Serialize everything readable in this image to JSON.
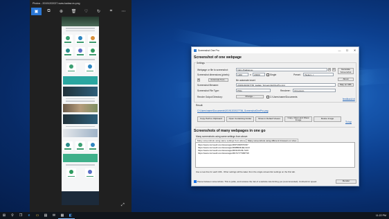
{
  "photos": {
    "title": "Photos - 20191202027.www.kadaw-eu.png",
    "toolbar": [
      {
        "icon": "image-icon",
        "glyph": "▣"
      },
      {
        "icon": "copy-icon",
        "glyph": "⧉"
      },
      {
        "icon": "zoom-icon",
        "glyph": "⊕"
      },
      {
        "icon": "delete-icon",
        "glyph": "🗑"
      },
      {
        "icon": "heart-icon",
        "glyph": "♡"
      },
      {
        "icon": "rotate-icon",
        "glyph": "↻"
      },
      {
        "icon": "crop-icon",
        "glyph": "⌗"
      },
      {
        "icon": "more-icon",
        "glyph": "⋯"
      }
    ],
    "expand_glyph": "⤢"
  },
  "app": {
    "window_title": "Screenshot One Pro",
    "controls": {
      "minimize": "—",
      "maximize": "☐",
      "close": "✕"
    },
    "section1_title": "Screenshot of one webpage",
    "settings_label": "Settings",
    "webpage_label": "Webpage or file to screenshot:",
    "webpage_value": "https://kadaw.eu",
    "dimensions_label": "Screenshot dimensions (pixels):",
    "width_value": "1200",
    "times": "x",
    "height_value": "20000",
    "height_note": "Single",
    "preset_label": "Preset:",
    "preset_value": "(Select...)",
    "generate_button": "Generate Screenshot",
    "automate_button": "Automate from...",
    "auto_note": "Be automate insert",
    "about_button": "About",
    "filename_label": "Screenshot filename:",
    "filename_value": "20191202027736_kadaw_ScreenshotOnePro.png",
    "stay_on_web_button": "Stay on URL",
    "filetype_label": "Screenshot File Type:",
    "filetype_value": "PNG",
    "renderer_label": "Renderer:",
    "renderer_value": "Chromium",
    "output_dir_label": "Render Output Directory:",
    "change_button": "Change...",
    "internet_checkbox": "C:\\Users\\name\\Documents",
    "feedback_link": "feedback.txt",
    "result_label": "Result:",
    "result_link": "C:\\Users\\name\\Documents\\20191202027736_ScreenshotOnePro.png",
    "action_buttons": [
      "Copy Path to Clipboard",
      "Open Containing Folder",
      "Show in Default Viewer",
      "Copy, Open and Show Image",
      "Delete Image"
    ],
    "to_top_link": "To top",
    "section2_title": "Screenshots of many webpages in one go",
    "many_desc": "Many screenshots using same settings from above:",
    "tabs": [
      "Many screenshots using same settings from above",
      "Many screenshots using different browsers or sizes"
    ],
    "urls": [
      "https://www.microsoft.com/store/apps/9WTW4PF5XD7",
      "https://www.microsoft.com/store/apps/9NBBFRHELGGX",
      "https://www.microsoft.com/store/apps/9NSNXG5L7L06",
      "https://www.microsoft.com/store/apps/9N7CT7T3BPTW"
    ],
    "hint": "Use a new line for each URL. Other settings will be taken from the single screenshot settings on the first tab.",
    "pause_checkbox": "Pause between screenshots. This is polite, and reduces the risk of a website rate limiting you (recommended). Uncheck for speed.",
    "render_button": "Render"
  },
  "taskbar": {
    "items": [
      {
        "icon": "start-icon",
        "glyph": "⊞"
      },
      {
        "icon": "search-icon",
        "glyph": "⚲"
      },
      {
        "icon": "task-view-icon",
        "glyph": "❐"
      },
      {
        "icon": "edge-icon",
        "glyph": "e"
      },
      {
        "icon": "file-explorer-icon",
        "glyph": "▭"
      },
      {
        "icon": "store-icon",
        "glyph": "▤"
      },
      {
        "icon": "mail-icon",
        "glyph": "✉"
      },
      {
        "icon": "photos-icon",
        "glyph": "▦"
      },
      {
        "icon": "screenshot-one-icon",
        "glyph": "◧"
      }
    ],
    "clock": "11:22 PM"
  }
}
